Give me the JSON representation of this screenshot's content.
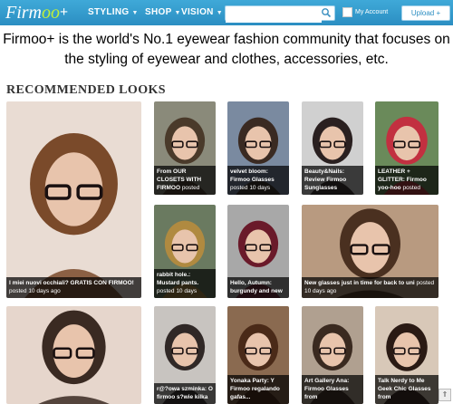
{
  "header": {
    "logo_main": "Firm",
    "logo_accent": "oo",
    "logo_plus": "+",
    "nav": [
      {
        "label": "STYLING"
      },
      {
        "label": "SHOP"
      },
      {
        "label": "VISION"
      }
    ],
    "search_placeholder": "",
    "account_label": "My Account",
    "upload_label": "Upload +"
  },
  "intro_text": "Firmoo+ is the world's No.1 eyewear fashion community that focuses on the styling of eyewear and clothes, accessories, etc.",
  "section_title": "RECOMMENDED LOOKS",
  "looks": [
    {
      "title": "I miei nuovi occhiali? GRATIS CON FIRMOO!",
      "meta": "posted 10 days ago",
      "colors": [
        "#e9dcd3",
        "#7a4a2a"
      ]
    },
    {
      "title": "From OUR CLOSETS WITH FIRMOO",
      "meta": "posted",
      "colors": [
        "#8a8a7a",
        "#4a3a2a"
      ]
    },
    {
      "title": "velvet bloom: Firmoo Glasses",
      "meta": "posted 10 days",
      "colors": [
        "#7a8aa0",
        "#3a2a22"
      ]
    },
    {
      "title": "Beauty&Nails: Review Firmoo Sunglasses",
      "meta": "",
      "colors": [
        "#d0d0d0",
        "#2a2020"
      ]
    },
    {
      "title": "LEATHER + GLITTER: Firmoo yoo-hoo",
      "meta": "posted",
      "colors": [
        "#6a8a5a",
        "#c23040"
      ]
    },
    {
      "title": "rabbit hole.: Mustard pants.",
      "meta": "posted 10 days",
      "colors": [
        "#6a7a60",
        "#b08a40"
      ]
    },
    {
      "title": "Hello, Autumn: burgundy and new",
      "meta": "",
      "colors": [
        "#a8a8a8",
        "#6a1a2a"
      ]
    },
    {
      "title": "New glasses just in time for back to uni",
      "meta": "posted 10 days ago",
      "colors": [
        "#b89a80",
        "#4a3020"
      ]
    },
    {
      "title": "",
      "meta": "",
      "colors": [
        "#e6d6cc",
        "#3a2a22"
      ]
    },
    {
      "title": "r@?owa szminka: O firmoo s?wie kilka",
      "meta": "",
      "colors": [
        "#c8c4c0",
        "#302826"
      ]
    },
    {
      "title": "Yonaka Party: Y Firmoo regalando gafas...",
      "meta": "",
      "colors": [
        "#8a6a50",
        "#4a2a18"
      ]
    },
    {
      "title": "Art Gallery Ana: Firmoo Glasses from",
      "meta": "",
      "colors": [
        "#b0a090",
        "#3a2a20"
      ]
    },
    {
      "title": "Talk Nerdy to Me Geek Chic Glasses from",
      "meta": "",
      "colors": [
        "#d8c8b8",
        "#2a1a14"
      ]
    }
  ],
  "scroll_top_symbol": "⇑"
}
